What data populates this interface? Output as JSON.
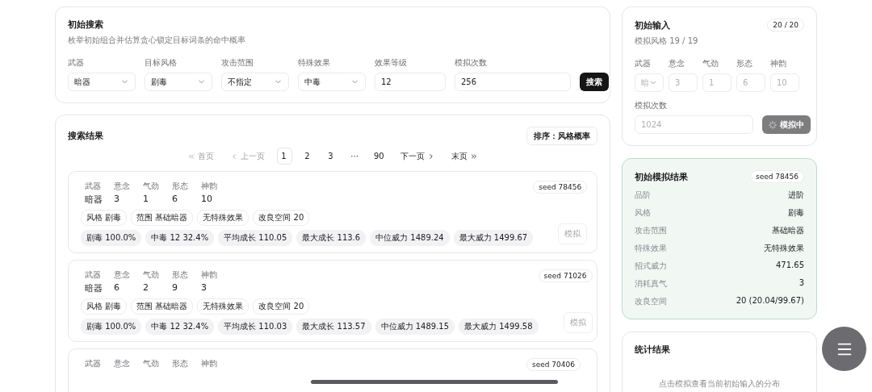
{
  "search": {
    "title": "初始搜索",
    "subtitle": "枚举初始组合并估算贪心锁定目标词条的命中概率",
    "fields": [
      {
        "label": "武器",
        "kind": "select",
        "value": "暗器"
      },
      {
        "label": "目标风格",
        "kind": "select",
        "value": "剧毒"
      },
      {
        "label": "攻击范围",
        "kind": "select",
        "value": "不指定"
      },
      {
        "label": "特殊效果",
        "kind": "select",
        "value": "中毒"
      },
      {
        "label": "效果等级",
        "kind": "input",
        "value": "12"
      },
      {
        "label": "模拟次数",
        "kind": "input",
        "value": "256"
      }
    ],
    "button": "搜索"
  },
  "results": {
    "title": "搜索结果",
    "sort_button": "排序：风格概率",
    "pagination": [
      {
        "label": "首页",
        "kind": "first",
        "selected": false,
        "disabled": true
      },
      {
        "label": "上一页",
        "kind": "prev",
        "selected": false,
        "disabled": true
      },
      {
        "label": "1",
        "kind": "page",
        "selected": true,
        "disabled": false
      },
      {
        "label": "2",
        "kind": "page",
        "selected": false,
        "disabled": false
      },
      {
        "label": "3",
        "kind": "page",
        "selected": false,
        "disabled": false
      },
      {
        "label": "···",
        "kind": "ellipsis",
        "selected": false,
        "disabled": false
      },
      {
        "label": "90",
        "kind": "page",
        "selected": false,
        "disabled": false
      },
      {
        "label": "下一页",
        "kind": "next",
        "selected": false,
        "disabled": false
      },
      {
        "label": "末页",
        "kind": "last",
        "selected": false,
        "disabled": false
      }
    ],
    "items": [
      {
        "stats": [
          {
            "label": "武器",
            "value": "暗器"
          },
          {
            "label": "意念",
            "value": "3"
          },
          {
            "label": "气劲",
            "value": "1"
          },
          {
            "label": "形态",
            "value": "6"
          },
          {
            "label": "神韵",
            "value": "10"
          }
        ],
        "seed": "seed 78456",
        "tags": [
          "风格 剧毒",
          "范围 基础暗器",
          "无特殊效果",
          "改良空间 20"
        ],
        "metrics": [
          "剧毒 100.0%",
          "中毒 12 32.4%",
          "平均成长 110.05",
          "最大成长 113.6",
          "中位威力 1489.24",
          "最大威力 1499.67"
        ],
        "button": "模拟"
      },
      {
        "stats": [
          {
            "label": "武器",
            "value": "暗器"
          },
          {
            "label": "意念",
            "value": "6"
          },
          {
            "label": "气劲",
            "value": "2"
          },
          {
            "label": "形态",
            "value": "9"
          },
          {
            "label": "神韵",
            "value": "3"
          }
        ],
        "seed": "seed 71026",
        "tags": [
          "风格 剧毒",
          "范围 基础暗器",
          "无特殊效果",
          "改良空间 20"
        ],
        "metrics": [
          "剧毒 100.0%",
          "中毒 12 32.4%",
          "平均成长 110.03",
          "最大成长 113.57",
          "中位威力 1489.15",
          "最大威力 1499.58"
        ],
        "button": "模拟"
      },
      {
        "stats": [
          {
            "label": "武器"
          },
          {
            "label": "意念"
          },
          {
            "label": "气劲"
          },
          {
            "label": "形态"
          },
          {
            "label": "神韵"
          }
        ],
        "seed": "seed 70406"
      }
    ]
  },
  "input_panel": {
    "title": "初始输入",
    "badge": "20 / 20",
    "subtitle": "模拟风格 19 / 19",
    "disabled": true,
    "fields": [
      {
        "label": "武器",
        "kind": "select",
        "value": "暗"
      },
      {
        "label": "意念",
        "kind": "input",
        "value": "3"
      },
      {
        "label": "气劲",
        "kind": "input",
        "value": "1"
      },
      {
        "label": "形态",
        "kind": "input",
        "value": "6"
      },
      {
        "label": "神韵",
        "kind": "input",
        "value": "10"
      }
    ],
    "count_label": "模拟次数",
    "count_value": "1024",
    "button": "模拟中"
  },
  "sim_result": {
    "title": "初始模拟结果",
    "seed": "seed 78456",
    "rows": [
      {
        "label": "品阶",
        "value": "进阶"
      },
      {
        "label": "风格",
        "value": "剧毒"
      },
      {
        "label": "攻击范围",
        "value": "基础暗器"
      },
      {
        "label": "特殊效果",
        "value": "无特殊效果"
      },
      {
        "label": "招式威力",
        "value": "471.65"
      },
      {
        "label": "消耗真气",
        "value": "3"
      },
      {
        "label": "改良空间",
        "value": "20 (20.04/99.67)"
      }
    ]
  },
  "stats_panel": {
    "title": "统计结果",
    "hint": "点击模拟查看当前初始输入的分布"
  }
}
